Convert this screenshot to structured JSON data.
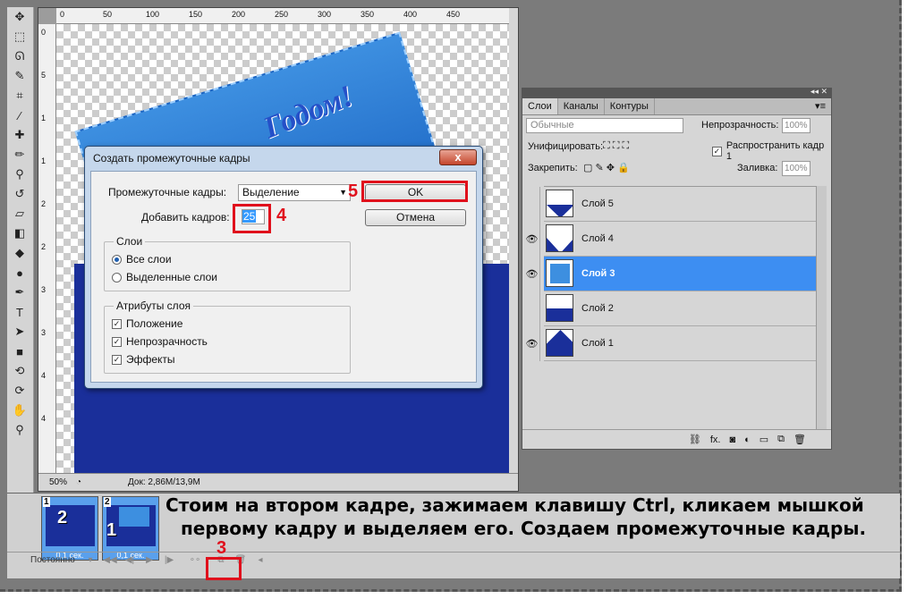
{
  "tools": {
    "icons": [
      "move-icon",
      "marquee-icon",
      "lasso-icon",
      "quick-select-icon",
      "crop-icon",
      "eyedropper-icon",
      "healing-icon",
      "brush-icon",
      "stamp-icon",
      "history-brush-icon",
      "eraser-icon",
      "gradient-icon",
      "blur-icon",
      "dodge-icon",
      "pen-icon",
      "type-icon",
      "path-select-icon",
      "shape-icon",
      "3d-icon",
      "3d-camera-icon",
      "hand-icon",
      "zoom-icon"
    ]
  },
  "document": {
    "ruler_top": [
      "0",
      "50",
      "100",
      "150",
      "200",
      "250",
      "300",
      "350",
      "400",
      "450"
    ],
    "ruler_left": [
      "0",
      "5",
      "1",
      "1",
      "2",
      "2",
      "3",
      "3",
      "4",
      "4"
    ],
    "canvas_text": "Годом!",
    "zoom": "50%",
    "doc_info": "Док: 2,86M/13,9M"
  },
  "dialog": {
    "title": "Создать промежуточные кадры",
    "tween_label": "Промежуточные кадры:",
    "tween_value": "Выделение",
    "frames_label": "Добавить кадров:",
    "frames_value": "25",
    "ok": "OK",
    "cancel": "Отмена",
    "layers_group": "Слои",
    "all_layers": "Все слои",
    "selected_layers": "Выделенные слои",
    "attr_group": "Атрибуты слоя",
    "position": "Положение",
    "opacity": "Непрозрачность",
    "effects": "Эффекты",
    "close": "x"
  },
  "annotations": {
    "n3": "3",
    "n4": "4",
    "n5": "5"
  },
  "layers_panel": {
    "tabs": [
      "Слои",
      "Каналы",
      "Контуры"
    ],
    "blend_mode": "Обычные",
    "opacity_label": "Непрозрачность:",
    "opacity_value": "100%",
    "unify_label": "Унифицировать:",
    "propagate": "Распространить кадр 1",
    "lock_label": "Закрепить:",
    "fill_label": "Заливка:",
    "fill_value": "100%",
    "layers": [
      {
        "name": "Слой 5",
        "visible": false,
        "selected": false
      },
      {
        "name": "Слой 4",
        "visible": true,
        "selected": false
      },
      {
        "name": "Слой 3",
        "visible": true,
        "selected": true
      },
      {
        "name": "Слой 2",
        "visible": false,
        "selected": false
      },
      {
        "name": "Слой 1",
        "visible": true,
        "selected": false
      }
    ],
    "bottom_icons": [
      "link-icon",
      "fx-icon",
      "mask-icon",
      "adjustment-icon",
      "group-icon",
      "new-layer-icon",
      "trash-icon"
    ],
    "fx": "fx."
  },
  "timeline": {
    "frames": [
      {
        "num": "1",
        "big": "2",
        "delay": "0,1 сек."
      },
      {
        "num": "2",
        "big": "1",
        "delay": "0,1 сек."
      }
    ],
    "loop": "Постоянно",
    "caption_line1": "Стоим на втором кадре, зажимаем клавишу Ctrl, кликаем мышкой",
    "caption_line2": "первому кадру и выделяем его. Создаем промежуточные кадры."
  }
}
